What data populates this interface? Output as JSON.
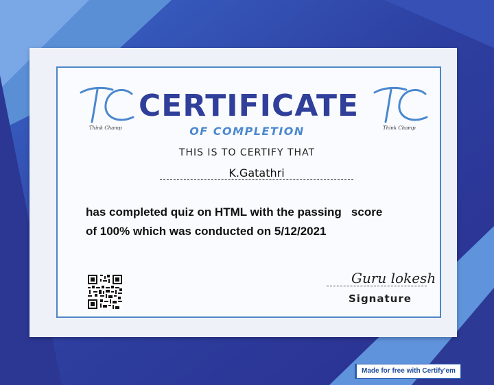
{
  "certificate": {
    "logo_letters": "TC",
    "logo_tagline": "Think Champ",
    "title": "CERTIFICATE",
    "subtitle": "OF COMPLETION",
    "certify_line": "THIS IS TO CERTIFY THAT",
    "recipient_name": "K.Gatathri",
    "body_line_1": "has completed quiz on HTML with the passing   score",
    "body_line_2": "of 100% which was conducted on 5/12/2021",
    "signature_script": "Guru lokesh",
    "signature_label": "Signature"
  },
  "footer": {
    "made_for_label": "Made for free with Certify'em"
  },
  "colors": {
    "navy": "#2e3f9e",
    "light_blue": "#4a88cf",
    "card": "#eef1f8"
  },
  "icons": [
    "tc-logo-icon",
    "qr-code-icon"
  ]
}
